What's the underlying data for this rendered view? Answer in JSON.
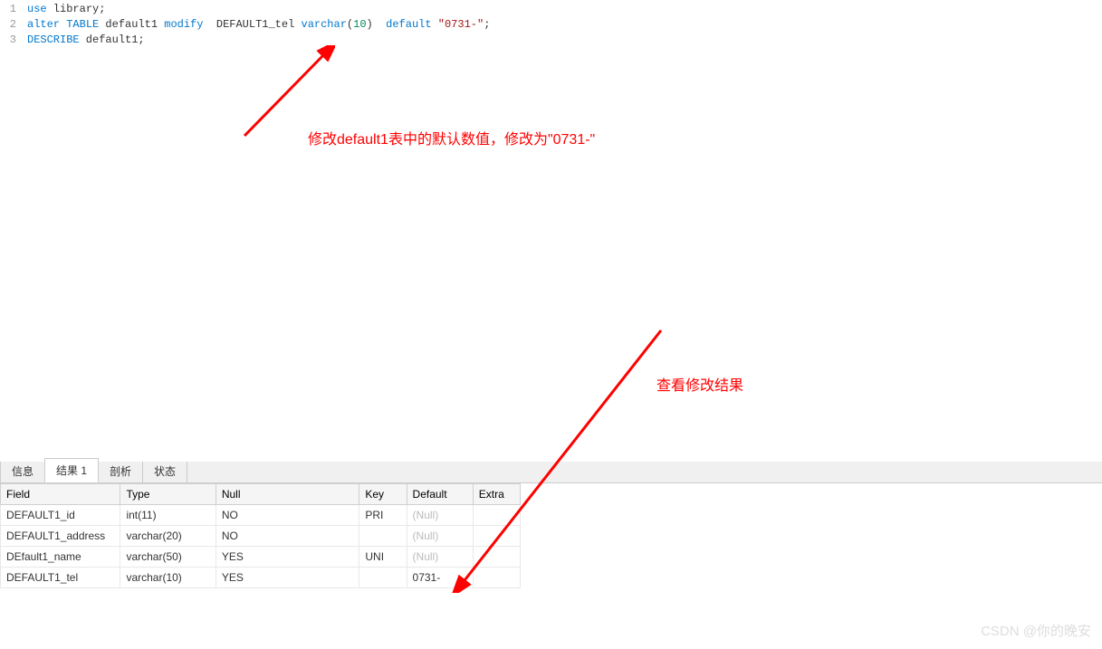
{
  "editor": {
    "lines": [
      {
        "num": "1",
        "tokens": [
          {
            "t": "use",
            "c": "kw"
          },
          {
            "t": " library;",
            "c": "ident"
          }
        ]
      },
      {
        "num": "2",
        "tokens": [
          {
            "t": "alter",
            "c": "kw"
          },
          {
            "t": " ",
            "c": "ident"
          },
          {
            "t": "TABLE",
            "c": "kw"
          },
          {
            "t": " default1 ",
            "c": "ident"
          },
          {
            "t": "modify",
            "c": "kw"
          },
          {
            "t": "  DEFAULT1_tel ",
            "c": "ident"
          },
          {
            "t": "varchar",
            "c": "type"
          },
          {
            "t": "(",
            "c": "ident"
          },
          {
            "t": "10",
            "c": "num"
          },
          {
            "t": ")  ",
            "c": "ident"
          },
          {
            "t": "default",
            "c": "kw"
          },
          {
            "t": " ",
            "c": "ident"
          },
          {
            "t": "\"0731-\"",
            "c": "str"
          },
          {
            "t": ";",
            "c": "ident"
          }
        ]
      },
      {
        "num": "3",
        "tokens": [
          {
            "t": "DESCRIBE",
            "c": "kw"
          },
          {
            "t": " default1;",
            "c": "ident"
          }
        ]
      }
    ]
  },
  "annotations": {
    "a1": "修改default1表中的默认数值，修改为\"0731-\"",
    "a2": "查看修改结果"
  },
  "tabs": [
    {
      "label": "信息",
      "active": false
    },
    {
      "label": "结果 1",
      "active": true
    },
    {
      "label": "剖析",
      "active": false
    },
    {
      "label": "状态",
      "active": false
    }
  ],
  "results": {
    "headers": [
      "Field",
      "Type",
      "Null",
      "Key",
      "Default",
      "Extra"
    ],
    "rows": [
      {
        "Field": "DEFAULT1_id",
        "Type": "int(11)",
        "Null": "NO",
        "Key": "PRI",
        "Default": "(Null)",
        "DefaultNull": true,
        "Extra": ""
      },
      {
        "Field": "DEFAULT1_address",
        "Type": "varchar(20)",
        "Null": "NO",
        "Key": "",
        "Default": "(Null)",
        "DefaultNull": true,
        "Extra": ""
      },
      {
        "Field": "DEfault1_name",
        "Type": "varchar(50)",
        "Null": "YES",
        "Key": "UNI",
        "Default": "(Null)",
        "DefaultNull": true,
        "Extra": ""
      },
      {
        "Field": "DEFAULT1_tel",
        "Type": "varchar(10)",
        "Null": "YES",
        "Key": "",
        "Default": "0731-",
        "DefaultNull": false,
        "Extra": ""
      }
    ]
  },
  "watermark": "CSDN @你的晚安"
}
